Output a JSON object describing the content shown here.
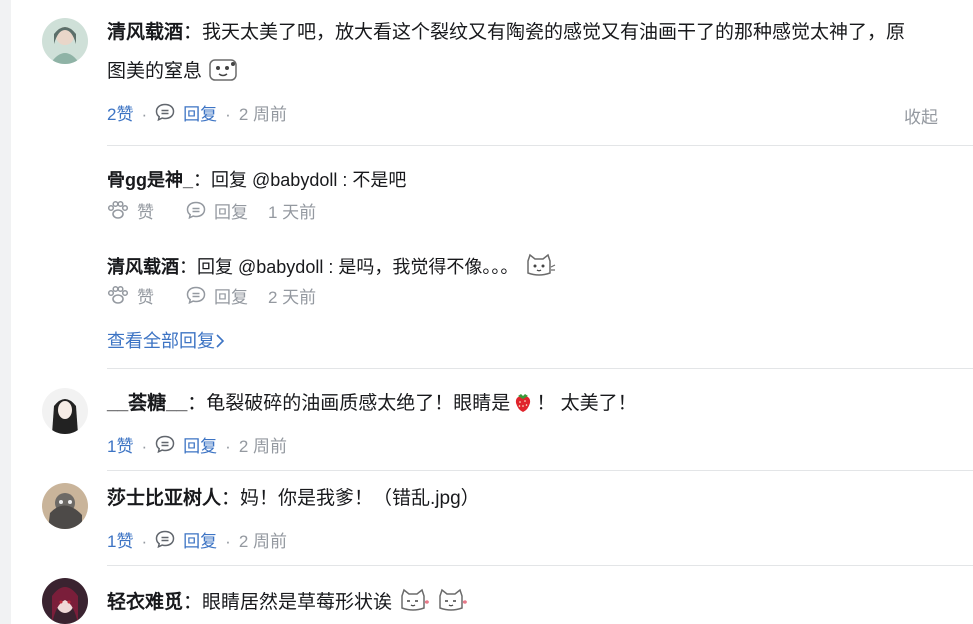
{
  "comments": [
    {
      "user": "清风载酒",
      "text_line1": "我天太美了吧，放大看这个裂纹又有陶瓷的感觉又有油画干了的那种感觉太神了，原",
      "text_line2": "图美的窒息",
      "likes": "2赞",
      "reply_label": "回复",
      "time": "2 周前",
      "collapse_label": "收起",
      "replies": [
        {
          "user": "骨gg是神_",
          "sep": "：",
          "text": "回复 @babydoll : 不是吧",
          "like_label": "赞",
          "reply_label": "回复",
          "time": "1 天前"
        },
        {
          "user": "清风载酒",
          "sep": "：",
          "text": "回复 @babydoll : 是吗，我觉得不像。。。",
          "like_label": "赞",
          "reply_label": "回复",
          "time": "2 天前"
        }
      ],
      "view_all": "查看全部回复"
    },
    {
      "user": "__荟糖__",
      "text": "龟裂破碎的油画质感太绝了！眼睛是",
      "text_tail": "！ 太美了！",
      "likes": "1赞",
      "reply_label": "回复",
      "time": "2 周前"
    },
    {
      "user": "莎士比亚树人",
      "text": "妈！你是我爹！（错乱.jpg）",
      "likes": "1赞",
      "reply_label": "回复",
      "time": "2 周前"
    },
    {
      "user": "轻衣难觅",
      "text": "眼睛居然是草莓形状诶"
    }
  ],
  "colon": "：",
  "colors": {
    "link": "#3d74c4",
    "muted": "#9499a0",
    "text": "#18191c",
    "divider": "#e3e5e7"
  }
}
